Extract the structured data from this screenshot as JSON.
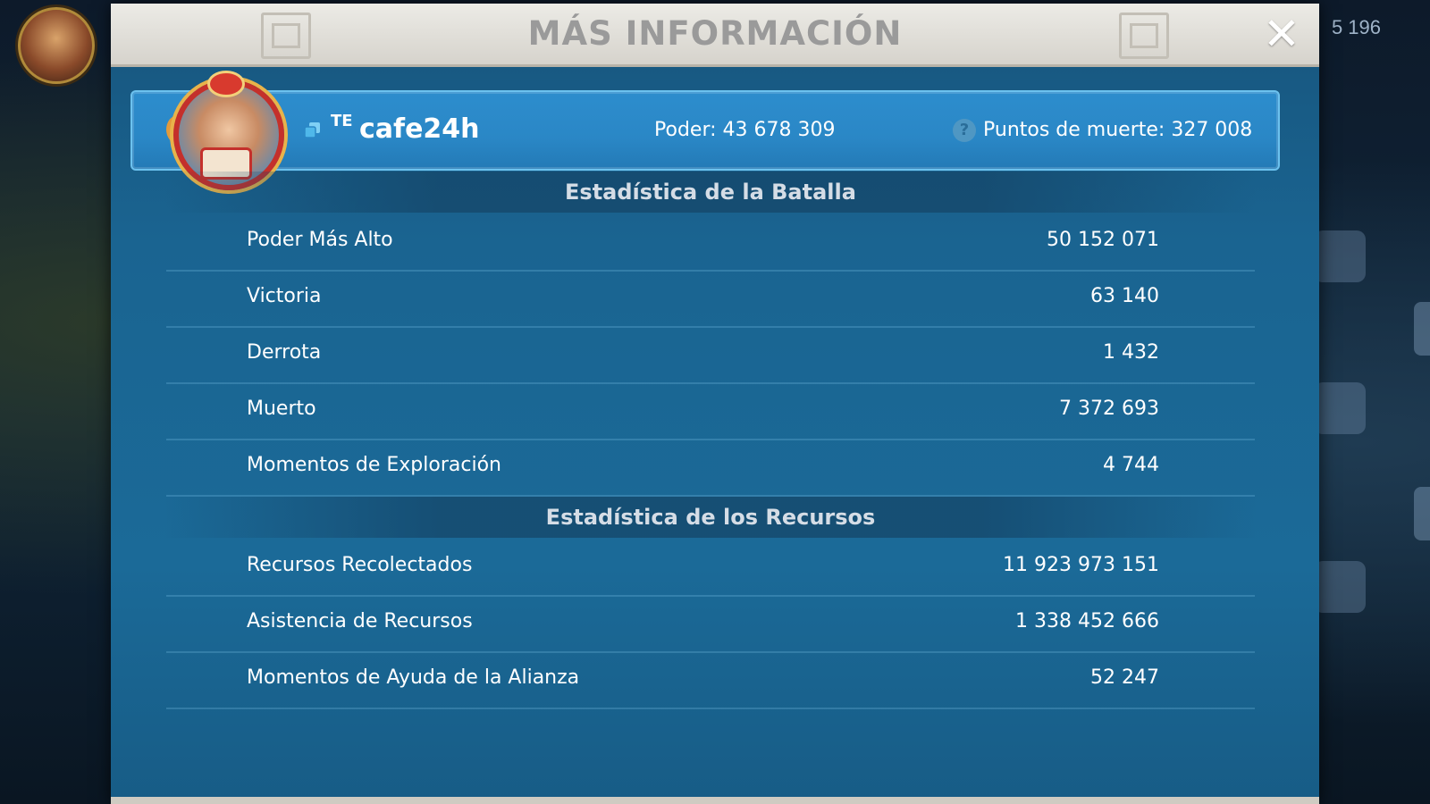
{
  "background": {
    "corner_number": "5 196"
  },
  "modal": {
    "title": "MÁS INFORMACIÓN",
    "close_glyph": "✕"
  },
  "player": {
    "alliance_tag": "TE",
    "name": "cafe24h",
    "power_text": "Poder: 43 678 309",
    "death_points_text": "Puntos de muerte: 327 008",
    "help_glyph": "?"
  },
  "battle": {
    "title": "Estadística de la Batalla",
    "rows": [
      {
        "label": "Poder Más Alto",
        "value": "50 152 071"
      },
      {
        "label": "Victoria",
        "value": "63 140"
      },
      {
        "label": "Derrota",
        "value": "1 432"
      },
      {
        "label": "Muerto",
        "value": "7 372 693"
      },
      {
        "label": "Momentos de Exploración",
        "value": "4 744"
      }
    ]
  },
  "resources": {
    "title": "Estadística de los Recursos",
    "rows": [
      {
        "label": "Recursos Recolectados",
        "value": "11 923 973 151"
      },
      {
        "label": "Asistencia de Recursos",
        "value": "1 338 452 666"
      },
      {
        "label": "Momentos de Ayuda de la Alianza",
        "value": "52 247"
      }
    ]
  },
  "icons": {
    "close": "close-icon",
    "copy": "copy-icon",
    "help": "help-icon",
    "avatar": "avatar"
  }
}
